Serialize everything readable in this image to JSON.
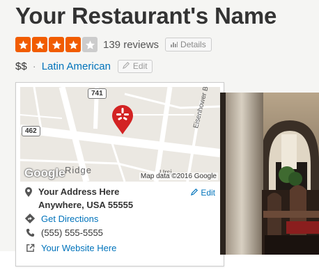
{
  "business": {
    "name": "Your Restaurant's Name",
    "review_count": "139 reviews",
    "details_label": "Details",
    "price": "$$",
    "separator": "·",
    "category": "Latin American",
    "edit_label": "Edit",
    "rating": {
      "value": 4,
      "max": 5
    },
    "colors": {
      "star_filled": "#f15c00",
      "star_empty": "#cccccc",
      "link": "#0073bb"
    }
  },
  "map": {
    "shields": [
      "741",
      "462"
    ],
    "road_label": "Eisenhower Blvd",
    "area_label": "Ridge",
    "partial_label": "Ursi",
    "logo": "Google",
    "attribution": "Map data ©2016 Google",
    "pin_icon": "yelp-burst-icon"
  },
  "card": {
    "address_line1": "Your Address Here",
    "address_line2": "Anywhere, USA 55555",
    "address_edit": "Edit",
    "directions": "Get Directions",
    "phone": "(555) 555-5555",
    "website": "Your Website Here"
  }
}
